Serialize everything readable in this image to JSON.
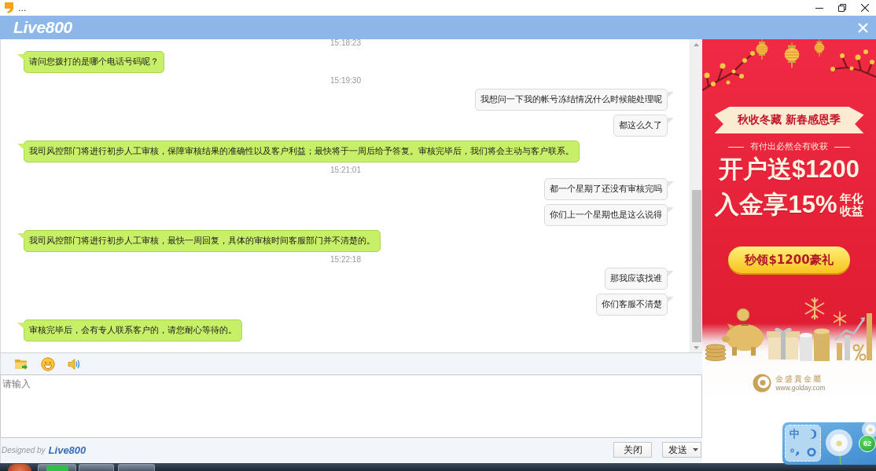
{
  "window": {
    "title": "..."
  },
  "header": {
    "logo": "Live800"
  },
  "chat": {
    "messages": [
      {
        "kind": "timestamp",
        "text": "15:18:23"
      },
      {
        "kind": "agent",
        "text": "请问您拨打的是哪个电话号码呢？"
      },
      {
        "kind": "timestamp",
        "text": "15:19:30"
      },
      {
        "kind": "visitor",
        "text": "我想问一下我的帐号冻结情况什么时候能处理呢"
      },
      {
        "kind": "visitor",
        "text": "都这么久了"
      },
      {
        "kind": "agent",
        "text": "我司风控部门将进行初步人工审核，保障审核结果的准确性以及客户利益；最快将于一周后给予答复。审核完毕后，我们将会主动与客户联系。"
      },
      {
        "kind": "timestamp",
        "text": "15:21:01"
      },
      {
        "kind": "visitor",
        "text": "都一个星期了还没有审核完吗"
      },
      {
        "kind": "visitor",
        "text": "你们上一个星期也是这么说得"
      },
      {
        "kind": "agent",
        "text": "我司风控部门将进行初步人工审核，最快一周回复，具体的审核时间客服部门并不清楚的。"
      },
      {
        "kind": "timestamp",
        "text": "15:22:18"
      },
      {
        "kind": "visitor",
        "text": "那我应该找谁"
      },
      {
        "kind": "visitor",
        "text": "你们客服不清楚"
      },
      {
        "kind": "agent",
        "text": "审核完毕后，会有专人联系客户的，请您耐心等待的。"
      }
    ]
  },
  "input": {
    "placeholder": "请输入"
  },
  "footer": {
    "credit": "Designed by",
    "brand": "Live800",
    "close_button": {
      "label": "关闭"
    },
    "send_button": {
      "label": "发送"
    }
  },
  "ad": {
    "ribbon": "秋收冬藏 新春感恩季",
    "tagline": "有付出必然会有收获",
    "headline": "开户送$1200",
    "subline": "入金享15%",
    "suffix": "年化收益",
    "cta": "秒领$1200豪礼",
    "brand": "金盛貴金屬",
    "url": "www.golday.com"
  },
  "ime": {
    "mode": "中",
    "badge": "62"
  }
}
